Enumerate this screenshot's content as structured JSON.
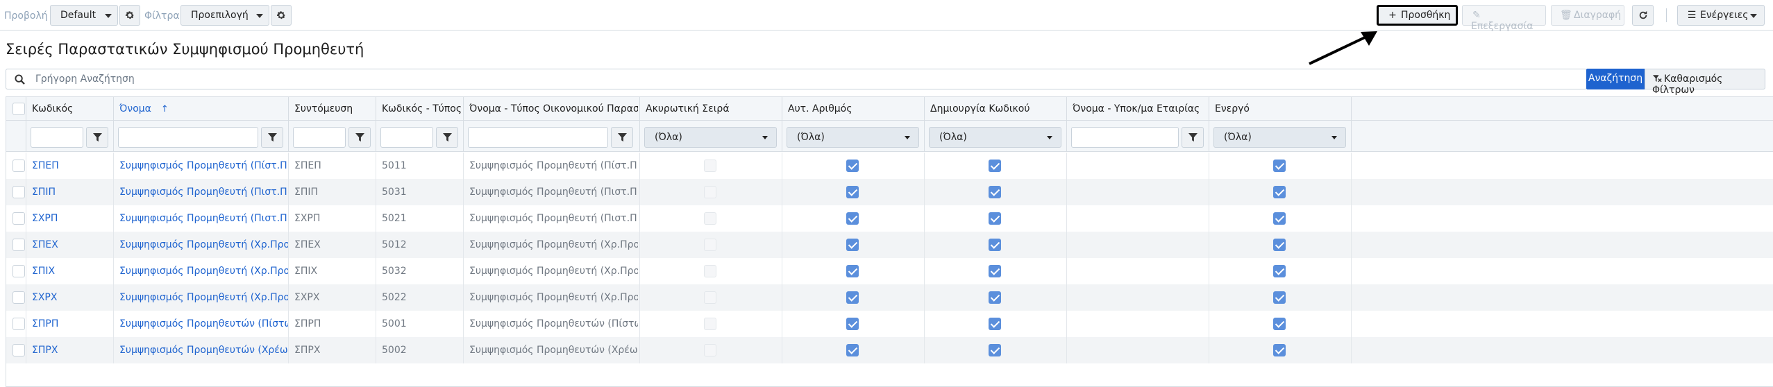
{
  "toolbar": {
    "view_label": "Προβολή",
    "view_value": "Default",
    "filter_label": "Φίλτρα",
    "filter_value": "Προεπιλογή",
    "add_label": "Προσθήκη",
    "edit_label": "Επεξεργασία",
    "delete_label": "Διαγραφή",
    "actions_label": "Ενέργειες"
  },
  "page": {
    "title": "Σειρές Παραστατικών Συμψηφισμού Προμηθευτή"
  },
  "search": {
    "placeholder": "Γρήγορη Αναζήτηση",
    "search_button": "Αναζήτηση",
    "clear_button": "Καθαρισμός Φίλτρων"
  },
  "grid": {
    "columns": [
      "Κωδικός",
      "Όνομα",
      "Συντόμευση",
      "Κωδικός - Τύπος Οικονομικ...",
      "Όνομα - Τύπος Οικονομικού Παραστατικού",
      "Ακυρωτική Σειρά",
      "Αυτ. Αριθμός",
      "Δημιουργία Κωδικού",
      "Όνομα - Υποκ/μα Εταιρίας",
      "Ενεργό"
    ],
    "sorted_column": "Όνομα",
    "sort_direction": "ascending",
    "filter_all": "(Όλα)",
    "rows": [
      {
        "code": "ΣΠΕΠ",
        "name": "Συμψηφισμός Προμηθευτή (Πίστ.Προμ.-Χρ.Πελ.)",
        "short": "ΣΠΕΠ",
        "doc_code": "5011",
        "doc_name": "Συμψηφισμός Προμηθευτή (Πίστ.Προμ.-Χρ.Πελ.)",
        "cancel": false,
        "auto_num": true,
        "create_code": true,
        "subsidiary": "",
        "active": true
      },
      {
        "code": "ΣΠΙΠ",
        "name": "Συμψηφισμός Προμηθευτή (Πιστ.Προμ.-Χρ.Πιστ.)",
        "short": "ΣΠΙΠ",
        "doc_code": "5031",
        "doc_name": "Συμψηφισμός Προμηθευτή (Πιστ.Προμ.-Χρ.Πιστ.)",
        "cancel": false,
        "auto_num": true,
        "create_code": true,
        "subsidiary": "",
        "active": true
      },
      {
        "code": "ΣΧΡΠ",
        "name": "Συμψηφισμός Προμηθευτή (Πιστ.Προμ.-Χρ.Χρ.)",
        "short": "ΣΧΡΠ",
        "doc_code": "5021",
        "doc_name": "Συμψηφισμός Προμηθευτή (Πιστ.Προμ.-Χρ.Χρ.)",
        "cancel": false,
        "auto_num": true,
        "create_code": true,
        "subsidiary": "",
        "active": true
      },
      {
        "code": "ΣΠΕΧ",
        "name": "Συμψηφισμός Προμηθευτή (Χρ.Προμ.-Πιστ.Πελ.)",
        "short": "ΣΠΕΧ",
        "doc_code": "5012",
        "doc_name": "Συμψηφισμός Προμηθευτή (Χρ.Προμ.-Πιστ.Πελ.)",
        "cancel": false,
        "auto_num": true,
        "create_code": true,
        "subsidiary": "",
        "active": true
      },
      {
        "code": "ΣΠΙΧ",
        "name": "Συμψηφισμός Προμηθευτή (Χρ.Προμ.-Πιστ.Πιστ.)",
        "short": "ΣΠΙΧ",
        "doc_code": "5032",
        "doc_name": "Συμψηφισμός Προμηθευτή (Χρ.Προμ.-Πιστ.Πιστ.)",
        "cancel": false,
        "auto_num": true,
        "create_code": true,
        "subsidiary": "",
        "active": true
      },
      {
        "code": "ΣΧΡΧ",
        "name": "Συμψηφισμός Προμηθευτή (Χρ.Προμ.-Πιστ.Χρ.)",
        "short": "ΣΧΡΧ",
        "doc_code": "5022",
        "doc_name": "Συμψηφισμός Προμηθευτή (Χρ.Προμ.-Πιστ.Χρ.)",
        "cancel": false,
        "auto_num": true,
        "create_code": true,
        "subsidiary": "",
        "active": true
      },
      {
        "code": "ΣΠΡΠ",
        "name": "Συμψηφισμός Προμηθευτών (Πίστωση - Αρνητική Πίστωση)",
        "short": "ΣΠΡΠ",
        "doc_code": "5001",
        "doc_name": "Συμψηφισμός Προμηθευτών (Πίστωση - Αρνητική Πίστωση)",
        "cancel": false,
        "auto_num": true,
        "create_code": true,
        "subsidiary": "",
        "active": true
      },
      {
        "code": "ΣΠΡΧ",
        "name": "Συμψηφισμός Προμηθευτών (Χρέωση - Αρνητική Χρέωση)",
        "short": "ΣΠΡΧ",
        "doc_code": "5002",
        "doc_name": "Συμψηφισμός Προμηθευτών (Χρέωση- Αρνητική Χρέωση)",
        "cancel": false,
        "auto_num": true,
        "create_code": true,
        "subsidiary": "",
        "active": true
      }
    ]
  },
  "colors": {
    "accent": "#1e63cf",
    "checkbox_checked": "#5b8fdc",
    "header_bg": "#f3f6f9"
  }
}
